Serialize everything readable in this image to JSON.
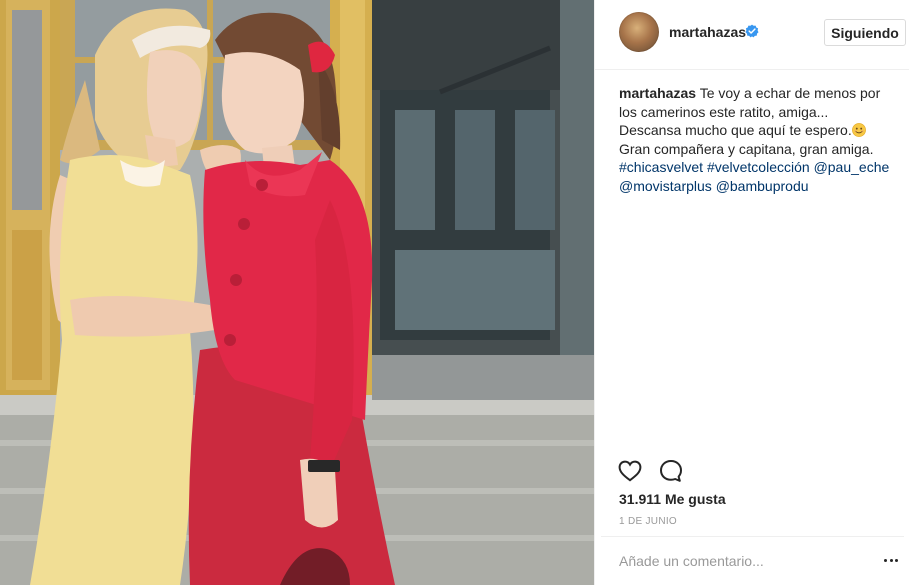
{
  "post": {
    "photo": {
      "alt": "",
      "colors": {
        "yellow_dress": "#f1dc8f",
        "red_jacket": "#e01b3d",
        "red_skirt": "#c81d34",
        "wall": "#a5aaa9",
        "door": "#2f3a3e",
        "window_frame": "#d8a63a"
      }
    },
    "header": {
      "username": "martahazas",
      "verified_icon": "verified-badge-icon",
      "follow_label": "Siguiendo"
    },
    "caption": {
      "author": "martahazas",
      "text_1": "Te voy a echar de menos por los camerinos este ratito, amiga... Descansa mucho que aquí te espero.",
      "emoji": "smiling-face-icon",
      "text_2": "Gran compañera y capitana, gran amiga.",
      "tags": [
        "#chicasvelvet",
        "#velvetcolección",
        "@pau_eche",
        "@movistarplus",
        "@bambuprodu"
      ]
    },
    "actions": {
      "like_icon": "heart-icon",
      "comment_icon": "comment-bubble-icon"
    },
    "likes": "31.911 Me gusta",
    "date": "1 DE JUNIO",
    "comment": {
      "placeholder": "Añade un comentario...",
      "more_icon": "more-options-icon"
    },
    "colors": {
      "text": "#262626",
      "link": "#003569",
      "muted": "#999999",
      "verified": "#3897f0",
      "border": "#efefef"
    }
  }
}
